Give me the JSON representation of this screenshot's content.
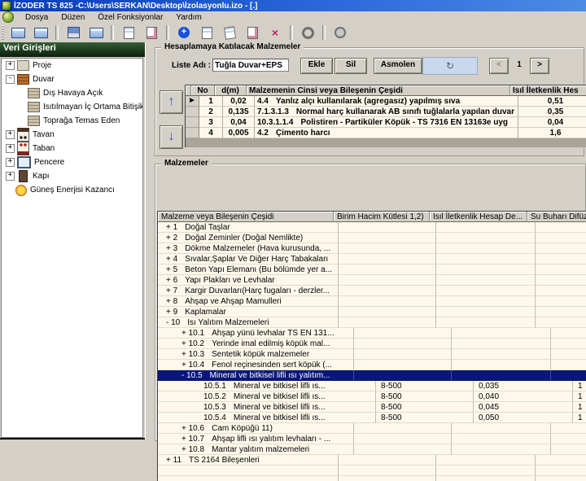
{
  "window": {
    "title": "İZODER TS 825 -C:\\Users\\SERKAN\\Desktop\\İzolasyonlu.izo - [.]"
  },
  "menu": {
    "items": [
      "Dosya",
      "Düzen",
      "Özel Fonksiyonlar",
      "Yardım"
    ]
  },
  "toolbar": {
    "groups": [
      [
        "new-file",
        "open-file"
      ],
      [
        "save",
        "export"
      ],
      [
        "report",
        "edit-check"
      ],
      [
        "add",
        "page-edit",
        "rotate",
        "draw",
        "delete"
      ],
      [
        "settings"
      ],
      [
        "help"
      ]
    ]
  },
  "sidebar": {
    "header": "Veri Girişleri",
    "tree": [
      {
        "expand": "+",
        "label": "Proje",
        "icon": "project-icon",
        "indent": 0
      },
      {
        "expand": "-",
        "label": "Duvar",
        "icon": "wall-icon",
        "indent": 0
      },
      {
        "expand": "",
        "label": "Dış Havaya Açık",
        "icon": "wall-sub-icon",
        "indent": 1
      },
      {
        "expand": "",
        "label": "Isıtılmayan İç Ortama Bitişik",
        "icon": "wall-sub-icon",
        "indent": 1
      },
      {
        "expand": "",
        "label": "Toprağa Temas Eden",
        "icon": "wall-sub-icon",
        "indent": 1
      },
      {
        "expand": "+",
        "label": "Tavan",
        "icon": "ceiling-icon",
        "indent": 0
      },
      {
        "expand": "+",
        "label": "Taban",
        "icon": "floor-icon",
        "indent": 0
      },
      {
        "expand": "+",
        "label": "Pencere",
        "icon": "window-icon",
        "indent": 0
      },
      {
        "expand": "+",
        "label": "Kapı",
        "icon": "door-icon",
        "indent": 0
      },
      {
        "expand": "",
        "label": "Güneş Enerjisi Kazancı",
        "icon": "sun-icon",
        "indent": 0
      }
    ]
  },
  "materials_panel": {
    "title": "Hesaplamaya Katılacak Malzemeler",
    "liste_adi_label": "Liste Adı :",
    "liste_adi_value": "Tuğla Duvar+EPS",
    "buttons": {
      "ekle": "Ekle",
      "sil": "Sil",
      "asmolen": "Asmolen",
      "prev": "<",
      "next": ">"
    },
    "page": "1",
    "refresh_glyph": "↻",
    "up_arrow": "↑",
    "down_arrow": "↓",
    "table": {
      "headers": [
        "No",
        "d(m)",
        "Malzemenin Cinsi veya Bileşenin Çeşidi",
        "Isıl İletkenlik Hes"
      ],
      "rows": [
        {
          "no": "1",
          "d": "0,02",
          "code": "4.4",
          "name": "Yanlız alçı kullanılarak (agregasız) yapılmış sıva",
          "val": "0,51"
        },
        {
          "no": "2",
          "d": "0,135",
          "code": "7.1.3.1.3",
          "name": "Normal harç kullanarak AB sınıfı tuğlalarla yapılan duvar",
          "val": "0,35"
        },
        {
          "no": "3",
          "d": "0,04",
          "code": "10.3.1.1.4",
          "name": "Polistiren - Partiküler Köpük - TS 7316 EN 13163e uyg",
          "val": "0,04"
        },
        {
          "no": "4",
          "d": "0,005",
          "code": "4.2",
          "name": "Çimento harcı",
          "val": "1,6"
        }
      ]
    }
  },
  "malzemeler_panel": {
    "title": "Malzemeler",
    "table": {
      "headers": [
        "Malzeme veya Bileşenin Çeşidi",
        "Birim Hacim Kütlesi 1,2)",
        "Isıl İletkenlik Hesap De...",
        "Su Buharı Difüzyo..."
      ],
      "rows": [
        {
          "prefix": "+",
          "code": "1",
          "name": "Doğal Taşlar",
          "bhk": "",
          "ile": "",
          "dif": "",
          "indent": 0,
          "selected": false
        },
        {
          "prefix": "+",
          "code": "2",
          "name": "Doğal Zeminler (Doğal Nemlikte)",
          "bhk": "",
          "ile": "",
          "dif": "",
          "indent": 0,
          "selected": false
        },
        {
          "prefix": "+",
          "code": "3",
          "name": "Dökme Malzemeler (Hava kurusunda, ...",
          "bhk": "",
          "ile": "",
          "dif": "",
          "indent": 0,
          "selected": false
        },
        {
          "prefix": "+",
          "code": "4",
          "name": "Sıvalar,Şaplar Ve Diğer Harç Tabakaları",
          "bhk": "",
          "ile": "",
          "dif": "",
          "indent": 0,
          "selected": false
        },
        {
          "prefix": "+",
          "code": "5",
          "name": "Beton Yapı Elemanı (Bu bölümde yer a...",
          "bhk": "",
          "ile": "",
          "dif": "",
          "indent": 0,
          "selected": false
        },
        {
          "prefix": "+",
          "code": "6",
          "name": "Yapı Plakları ve Levhalar",
          "bhk": "",
          "ile": "",
          "dif": "",
          "indent": 0,
          "selected": false
        },
        {
          "prefix": "+",
          "code": "7",
          "name": "Kargir Duvarları(Harç fugaları - derzler...",
          "bhk": "",
          "ile": "",
          "dif": "",
          "indent": 0,
          "selected": false
        },
        {
          "prefix": "+",
          "code": "8",
          "name": "Ahşap ve Ahşap Mamulleri",
          "bhk": "",
          "ile": "",
          "dif": "",
          "indent": 0,
          "selected": false
        },
        {
          "prefix": "+",
          "code": "9",
          "name": "Kaplamalar",
          "bhk": "",
          "ile": "",
          "dif": "",
          "indent": 0,
          "selected": false
        },
        {
          "prefix": "-",
          "code": "10",
          "name": "Isı Yalıtım Malzemeleri",
          "bhk": "",
          "ile": "",
          "dif": "",
          "indent": 0,
          "selected": false
        },
        {
          "prefix": "+",
          "code": "10.1",
          "name": "Ahşap yünü levhalar TS EN 131...",
          "bhk": "",
          "ile": "",
          "dif": "",
          "indent": 1,
          "selected": false
        },
        {
          "prefix": "+",
          "code": "10.2",
          "name": "Yerinde imal edilmiş köpük mal...",
          "bhk": "",
          "ile": "",
          "dif": "",
          "indent": 1,
          "selected": false
        },
        {
          "prefix": "+",
          "code": "10.3",
          "name": "Sentetik köpük malzemeler",
          "bhk": "",
          "ile": "",
          "dif": "",
          "indent": 1,
          "selected": false
        },
        {
          "prefix": "+",
          "code": "10.4",
          "name": "Fenol reçinesinden sert köpük (...",
          "bhk": "",
          "ile": "",
          "dif": "",
          "indent": 1,
          "selected": false
        },
        {
          "prefix": "-",
          "code": "10.5",
          "name": "Mineral ve bitkisel lifli ısı yalıtım...",
          "bhk": "",
          "ile": "",
          "dif": "",
          "indent": 1,
          "selected": true
        },
        {
          "prefix": "",
          "code": "10.5.1",
          "name": "Mineral ve bitkisel lifli ıs...",
          "bhk": "8-500",
          "ile": "0,035",
          "dif": "1",
          "indent": 2,
          "selected": false
        },
        {
          "prefix": "",
          "code": "10.5.2",
          "name": "Mineral ve bitkisel lifli ıs...",
          "bhk": "8-500",
          "ile": "0,040",
          "dif": "1",
          "indent": 2,
          "selected": false
        },
        {
          "prefix": "",
          "code": "10.5.3",
          "name": "Mineral ve bitkisel lifli ıs...",
          "bhk": "8-500",
          "ile": "0,045",
          "dif": "1",
          "indent": 2,
          "selected": false
        },
        {
          "prefix": "",
          "code": "10.5.4",
          "name": "Mineral ve bitkisel lifli ıs...",
          "bhk": "8-500",
          "ile": "0,050",
          "dif": "1",
          "indent": 2,
          "selected": false
        },
        {
          "prefix": "+",
          "code": "10.6",
          "name": "Cam Köpüğü  11)",
          "bhk": "",
          "ile": "",
          "dif": "",
          "indent": 1,
          "selected": false
        },
        {
          "prefix": "+",
          "code": "10.7",
          "name": "Ahşap lifli ısı yalıtım levhaları - ...",
          "bhk": "",
          "ile": "",
          "dif": "",
          "indent": 1,
          "selected": false
        },
        {
          "prefix": "+",
          "code": "10.8",
          "name": "Mantar yalıtım malzemeleri",
          "bhk": "",
          "ile": "",
          "dif": "",
          "indent": 1,
          "selected": false
        },
        {
          "prefix": "+",
          "code": "11",
          "name": "TS 2164 Bileşenleri",
          "bhk": "",
          "ile": "",
          "dif": "",
          "indent": 0,
          "selected": false
        },
        {
          "prefix": "",
          "code": "",
          "name": "",
          "bhk": "",
          "ile": "",
          "dif": "",
          "indent": 0,
          "selected": false
        },
        {
          "prefix": "",
          "code": "",
          "name": "",
          "bhk": "",
          "ile": "",
          "dif": "",
          "indent": 0,
          "selected": false
        }
      ]
    }
  }
}
